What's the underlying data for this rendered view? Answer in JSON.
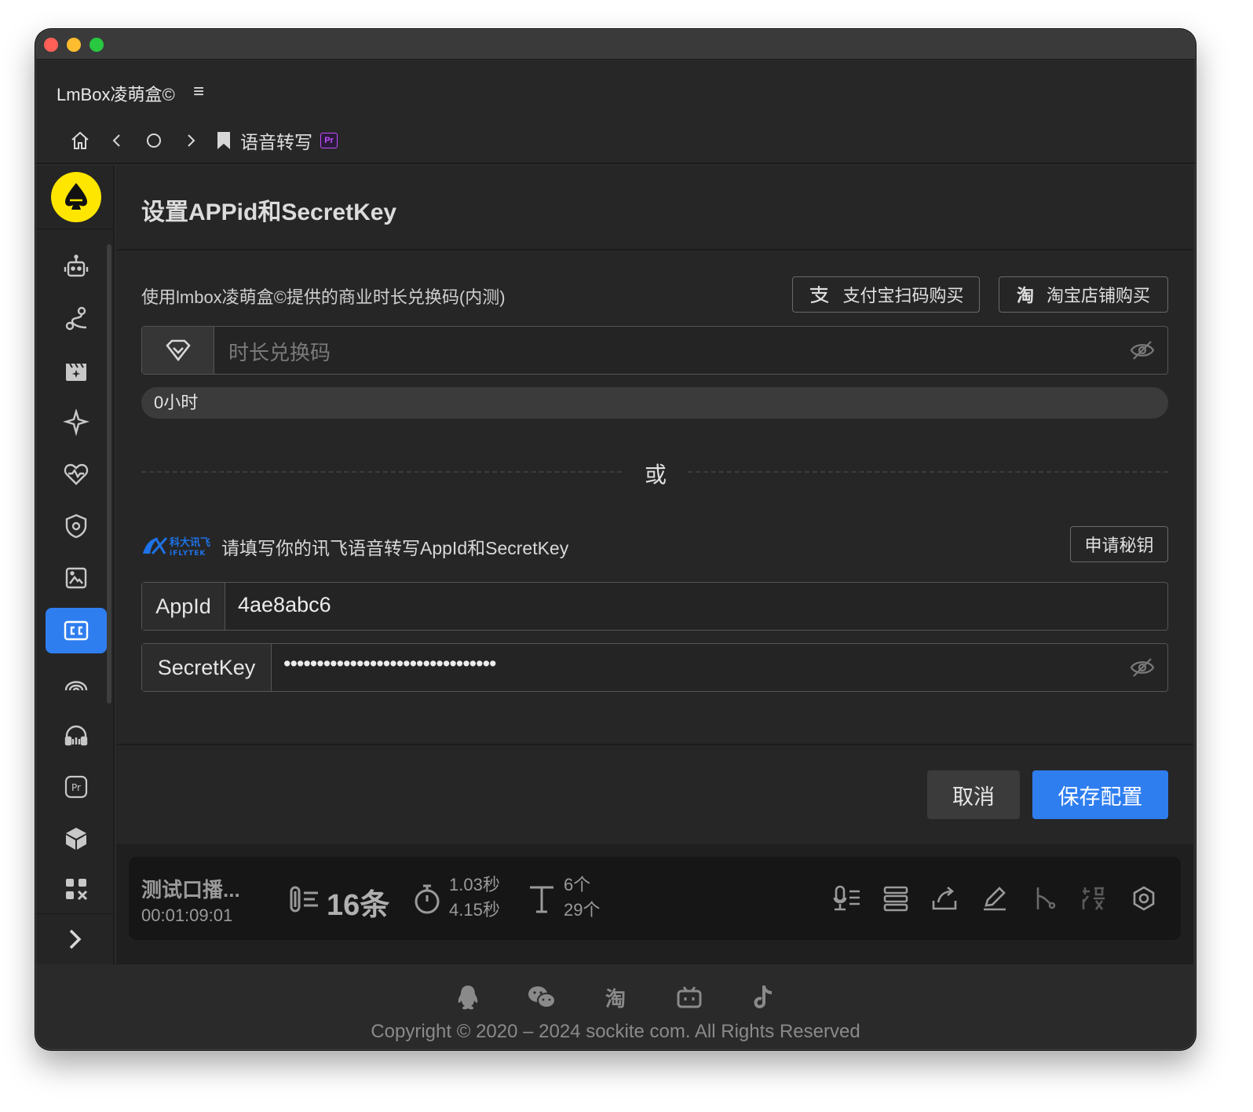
{
  "app": {
    "title": "LmBox凌萌盒©",
    "menu_glyph": "≡"
  },
  "breadcrumb": {
    "page": "语音转写",
    "badge": "Pr"
  },
  "dialog": {
    "title": "设置APPid和SecretKey",
    "redeem_label": "使用lmbox凌萌盒©提供的商业时长兑换码(内测)",
    "alipay_button": "支付宝扫码购买",
    "taobao_button": "淘宝店铺购买",
    "code_placeholder": "时长兑换码",
    "hours_value": "0小时",
    "or_text": "或",
    "iflytek_brand": "科大讯飞",
    "iflytek_sub": "iFLYTEK",
    "iflytek_label": "请填写你的讯飞语音转写AppId和SecretKey",
    "apply_button": "申请秘钥",
    "appid_label": "AppId",
    "appid_value": "4ae8abc6",
    "secretkey_label": "SecretKey",
    "secretkey_value": "••••••••••••••••••••••••••••••••",
    "cancel_button": "取消",
    "save_button": "保存配置"
  },
  "statusbar": {
    "title": "测试口播...",
    "timecode": "00:01:09:01",
    "count": "16条",
    "duration_1": "1.03秒",
    "duration_2": "4.15秒",
    "chars_1": "6个",
    "chars_2": "29个"
  },
  "footer": {
    "taobao_glyph": "淘",
    "copyright": "Copyright © 2020 – 2024 sockite com. All Rights Reserved"
  },
  "colors": {
    "accent": "#2f7ef0",
    "logo_yellow": "#ffe600",
    "pr_badge": "#c04cff",
    "background": "#262627"
  },
  "sidebar": {
    "items": [
      "robot-icon",
      "route-icon",
      "clapper-icon",
      "sparkle-icon",
      "heart-pulse-icon",
      "shield-icon",
      "image-icon",
      "cc-icon",
      "broadcast-icon",
      "headphones-icon",
      "pr-icon",
      "box-icon",
      "puzzle-icon"
    ],
    "active": "cc-icon"
  }
}
